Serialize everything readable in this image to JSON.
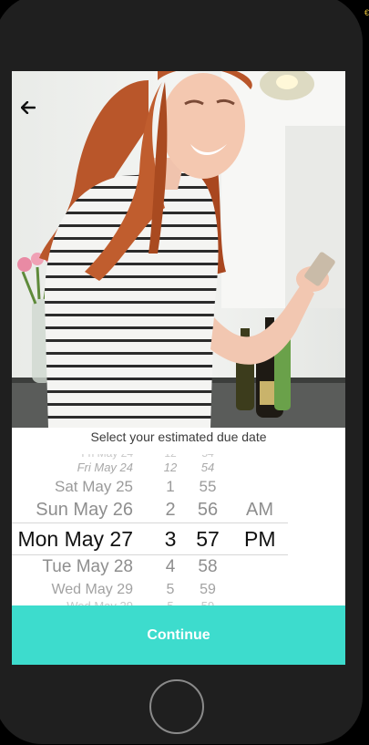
{
  "status": {
    "edge_glyph": "€"
  },
  "header": {
    "back_icon": "arrow-left-icon"
  },
  "hero": {
    "image_subject": "smiling pregnant woman holding a phone in a kitchen"
  },
  "prompt": {
    "text": "Select your estimated due date"
  },
  "picker": {
    "rows": [
      {
        "date": "Fri May 24",
        "hour": "12",
        "minute": "54",
        "ampm": ""
      },
      {
        "date": "Sat May 25",
        "hour": "1",
        "minute": "55",
        "ampm": ""
      },
      {
        "date": "Sun May 26",
        "hour": "2",
        "minute": "56",
        "ampm": "AM"
      },
      {
        "date": "Mon May 27",
        "hour": "3",
        "minute": "57",
        "ampm": "PM"
      },
      {
        "date": "Tue May 28",
        "hour": "4",
        "minute": "58",
        "ampm": ""
      },
      {
        "date": "Wed May 29",
        "hour": "5",
        "minute": "59",
        "ampm": ""
      }
    ],
    "selected_index": 3
  },
  "cta": {
    "label": "Continue"
  },
  "colors": {
    "accent": "#3ddccd"
  }
}
